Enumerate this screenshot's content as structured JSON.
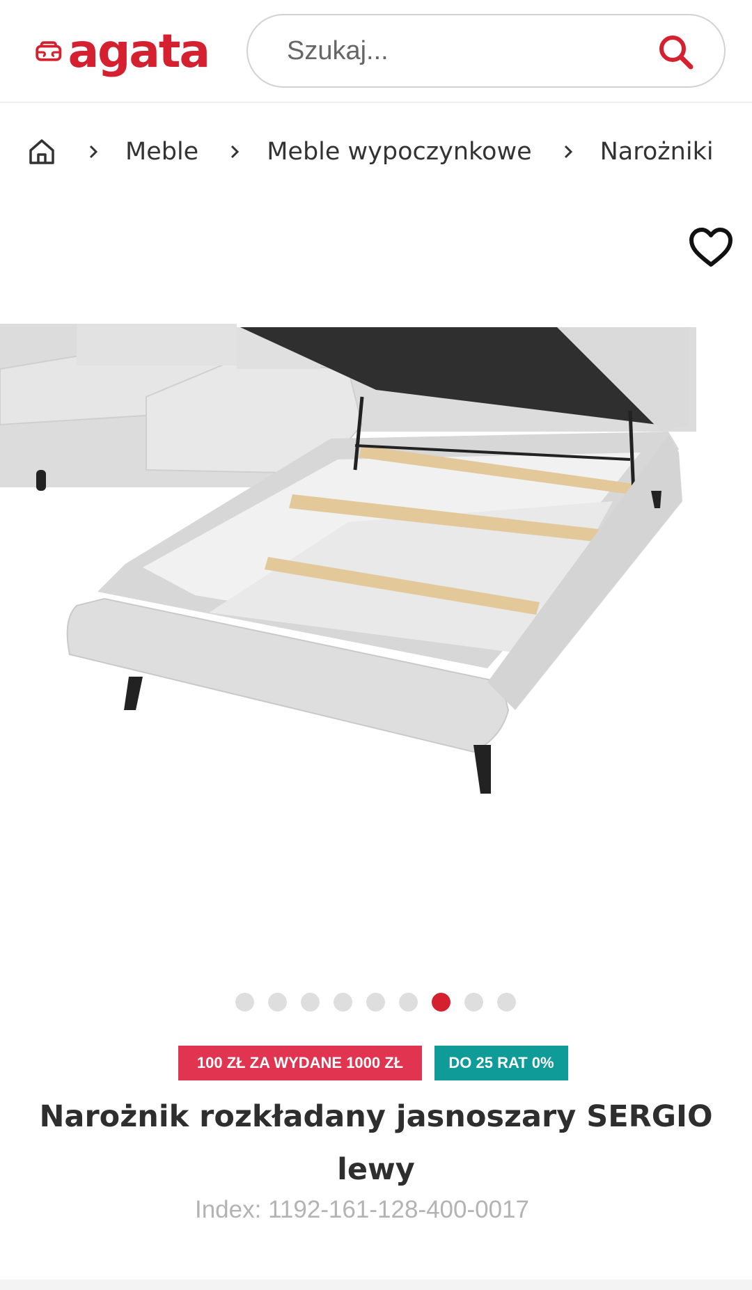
{
  "header": {
    "logo_text": "agata",
    "search_placeholder": "Szukaj...",
    "search_icon": "search-icon",
    "brand_color": "#d4202f"
  },
  "breadcrumb": {
    "home_icon": "home-icon",
    "items": [
      "Meble",
      "Meble wypoczynkowe",
      "Narożniki"
    ]
  },
  "product": {
    "favorite_icon": "heart-icon",
    "gallery": {
      "total_images": 9,
      "active_index": 6
    },
    "badges": [
      {
        "label": "100 ZŁ ZA WYDANE 1000 ZŁ",
        "color": "#e03450"
      },
      {
        "label": "DO 25 RAT 0%",
        "color": "#0f9c98"
      }
    ],
    "title": "Narożnik rozkładany jasnoszary SERGIO lewy",
    "index": "Index: 1192-161-128-400-0017"
  }
}
